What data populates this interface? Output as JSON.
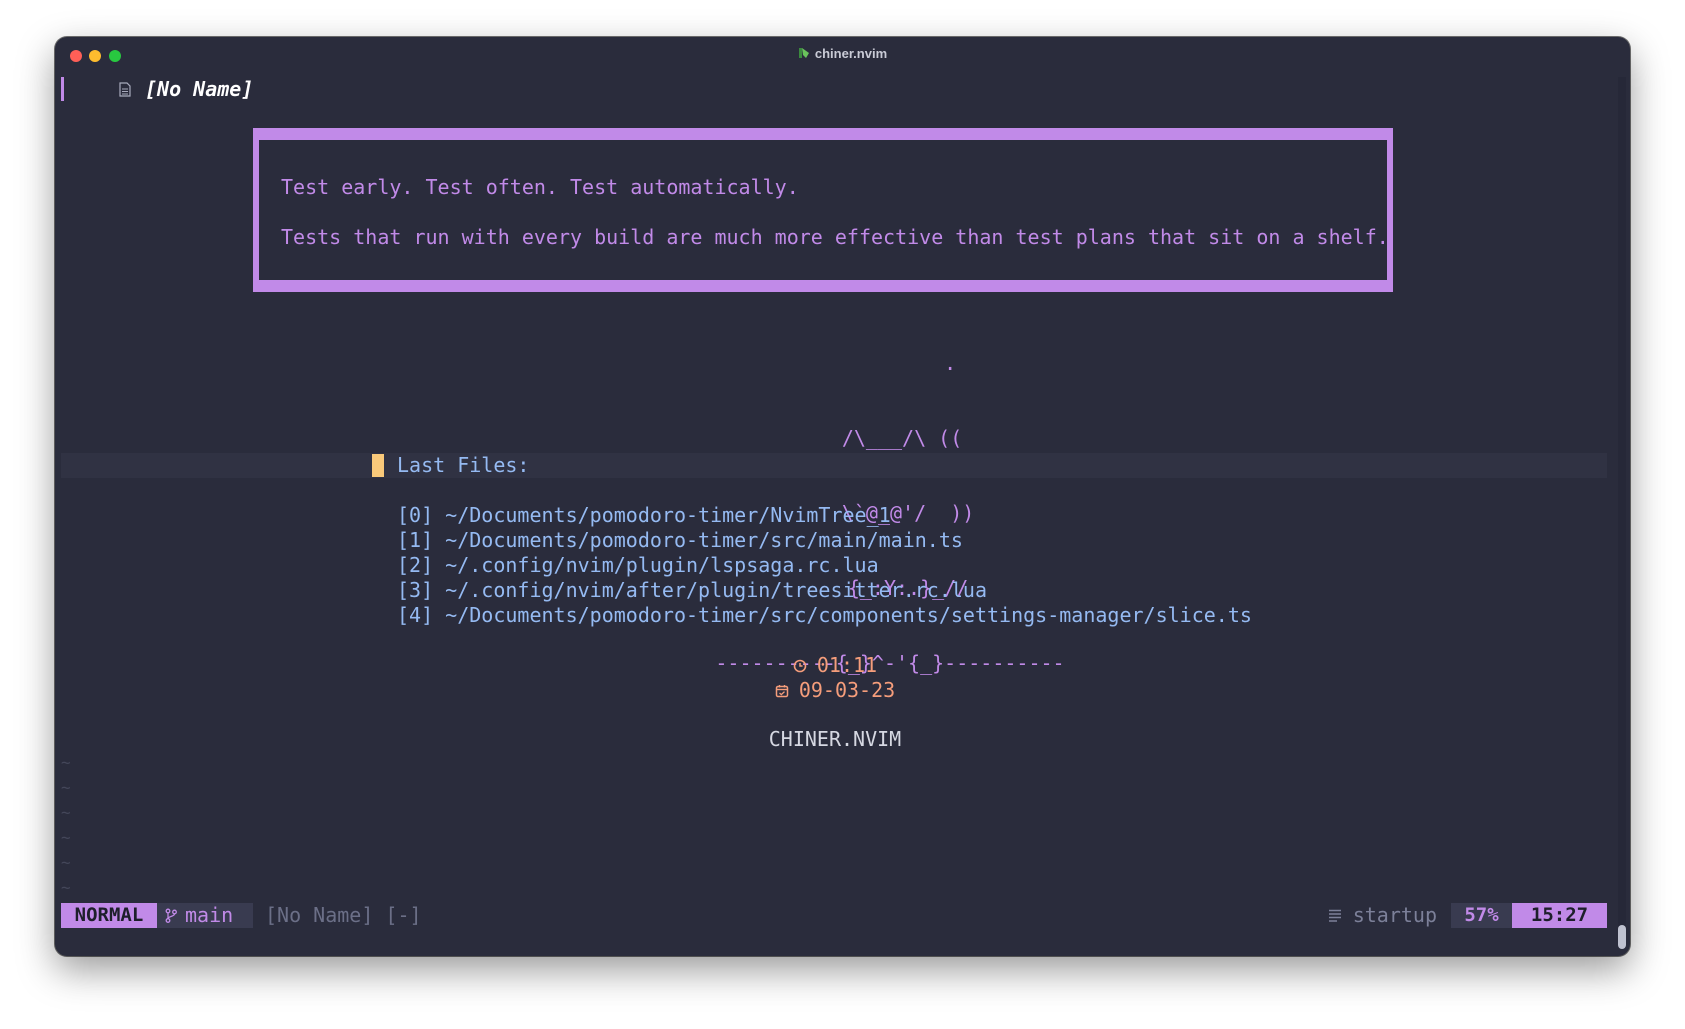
{
  "window": {
    "title": "chiner.nvim",
    "controls": [
      "close",
      "minimize",
      "maximize"
    ]
  },
  "tabline": {
    "tab_name": "[No Name]",
    "icon": "file-icon"
  },
  "dashboard": {
    "quote": [
      "Test early. Test often. Test automatically.",
      "Tests that run with every build are much more effective than test plans that sit on a shelf."
    ],
    "ascii_art": [
      "          .",
      "  /\\___/\\ ((",
      "   \\`@_@'/  ))",
      "   {_:Y:.}_//",
      "----------{_}^-'{_}----------"
    ],
    "last_files_label": "Last Files:",
    "files": [
      "[0] ~/Documents/pomodoro-timer/NvimTree_1",
      "[1] ~/Documents/pomodoro-timer/src/main/main.ts",
      "[2] ~/.config/nvim/plugin/lspsaga.rc.lua",
      "[3] ~/.config/nvim/after/plugin/treesitter.rc.lua",
      "[4] ~/Documents/pomodoro-timer/src/components/settings-manager/slice.ts"
    ],
    "time": "01:11",
    "date": "09-03-23",
    "footer": "CHINER.NVIM"
  },
  "statusline": {
    "mode": "NORMAL",
    "branch": "main",
    "file": "[No Name] [-]",
    "filetype": "startup",
    "percent": "57%",
    "clock": "15:27"
  },
  "colors": {
    "background": "#2a2c3c",
    "accent": "#c18ae8",
    "files": "#95baf2",
    "time": "#f59d7b",
    "cursor": "#f9c97a"
  }
}
